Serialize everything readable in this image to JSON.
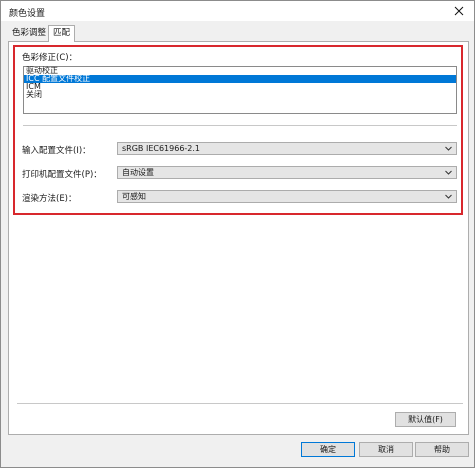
{
  "window": {
    "title": "颜色设置"
  },
  "tabs": [
    {
      "label": "色彩调整"
    },
    {
      "label": "匹配"
    }
  ],
  "matching": {
    "color_correction_label": "色彩修正(C)：",
    "color_correction_options": [
      "驱动校正",
      "ICC 配置文件校正",
      "ICM",
      "关闭"
    ],
    "color_correction_selected": "ICC 配置文件校正",
    "input_profile_label": "输入配置文件(I)：",
    "input_profile_value": "sRGB IEC61966-2.1",
    "printer_profile_label": "打印机配置文件(P)：",
    "printer_profile_value": "自动设置",
    "rendering_intent_label": "渲染方法(E)：",
    "rendering_intent_value": "可感知"
  },
  "panel_buttons": {
    "defaults": "默认值(F)"
  },
  "dialog_buttons": {
    "ok": "确定",
    "cancel": "取消",
    "help": "帮助"
  },
  "colors": {
    "highlight_frame": "#d8282d",
    "selection": "#0078d7"
  },
  "icons": {
    "close": "close-icon",
    "dropdown": "chevron-down-icon"
  }
}
